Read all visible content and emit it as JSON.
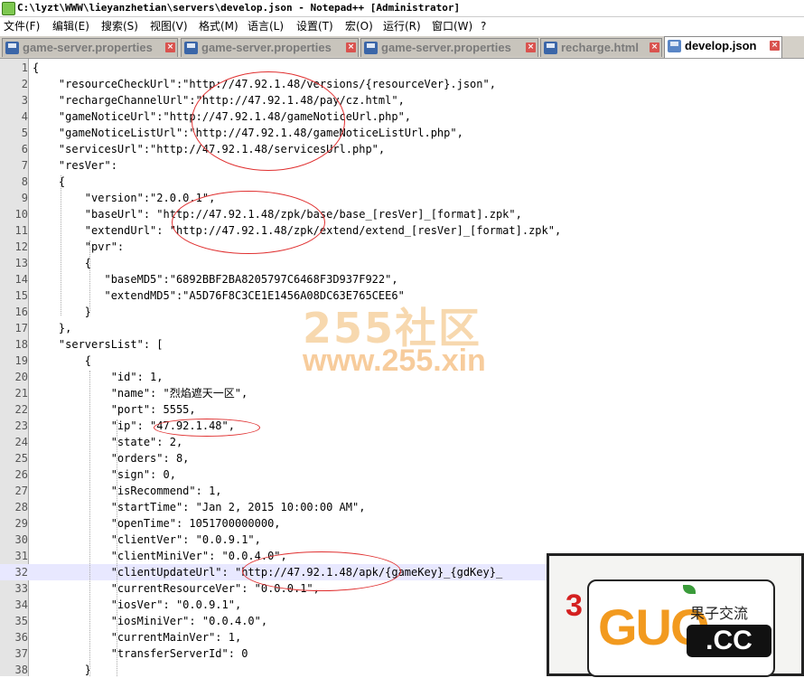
{
  "window": {
    "title": "C:\\lyzt\\WWW\\lieyanzhetian\\servers\\develop.json - Notepad++ [Administrator]"
  },
  "menu": [
    "文件(F)",
    "编辑(E)",
    "搜索(S)",
    "视图(V)",
    "格式(M)",
    "语言(L)",
    "设置(T)",
    "宏(O)",
    "运行(R)",
    "窗口(W)",
    "?"
  ],
  "tabs": [
    {
      "label": "game-server.properties",
      "active": false
    },
    {
      "label": "game-server.properties",
      "active": false
    },
    {
      "label": "game-server.properties",
      "active": false
    },
    {
      "label": "recharge.html",
      "active": false
    },
    {
      "label": "develop.json",
      "active": true
    }
  ],
  "editor": {
    "current_line": 32,
    "lines": [
      "{",
      "    \"resourceCheckUrl\":\"http://47.92.1.48/versions/{resourceVer}.json\",",
      "    \"rechargeChannelUrl\":\"http://47.92.1.48/pay/cz.html\",",
      "    \"gameNoticeUrl\":\"http://47.92.1.48/gameNoticeUrl.php\",",
      "    \"gameNoticeListUrl\":\"http://47.92.1.48/gameNoticeListUrl.php\",",
      "    \"servicesUrl\":\"http://47.92.1.48/servicesUrl.php\",",
      "    \"resVer\":",
      "    {",
      "        \"version\":\"2.0.0.1\",",
      "        \"baseUrl\": \"http://47.92.1.48/zpk/base/base_[resVer]_[format].zpk\",",
      "        \"extendUrl\": \"http://47.92.1.48/zpk/extend/extend_[resVer]_[format].zpk\",",
      "        \"pvr\":",
      "        {",
      "           \"baseMD5\":\"6892BBF2BA8205797C6468F3D937F922\",",
      "           \"extendMD5\":\"A5D76F8C3CE1E1456A08DC63E765CEE6\"",
      "        }",
      "    },",
      "    \"serversList\": [",
      "        {",
      "            \"id\": 1,",
      "            \"name\": \"烈焰遮天一区\",",
      "            \"port\": 5555,",
      "            \"ip\": \"47.92.1.48\",",
      "            \"state\": 2,",
      "            \"orders\": 8,",
      "            \"sign\": 0,",
      "            \"isRecommend\": 1,",
      "            \"startTime\": \"Jan 2, 2015 10:00:00 AM\",",
      "            \"openTime\": 1051700000000,",
      "            \"clientVer\": \"0.0.9.1\",",
      "            \"clientMiniVer\": \"0.0.4.0\",",
      "            \"clientUpdateUrl\": \"http://47.92.1.48/apk/{gameKey}_{gdKey}_",
      "            \"currentResourceVer\": \"0.0.0.1\",",
      "            \"iosVer\": \"0.0.9.1\",",
      "            \"iosMiniVer\": \"0.0.4.0\",",
      "            \"currentMainVer\": 1,",
      "            \"transferServerId\": 0",
      "        }"
    ]
  },
  "watermark": {
    "text_top": "255社区",
    "text_bottom": "www.255.xin"
  },
  "stamp": {
    "digit": "3",
    "brand": "GUO",
    "cn": "果子交流",
    "domain": ".CC"
  },
  "colors": {
    "annotation_circle": "#e03030",
    "watermark": "#f2be78",
    "brand_orange": "#f29a1f"
  }
}
